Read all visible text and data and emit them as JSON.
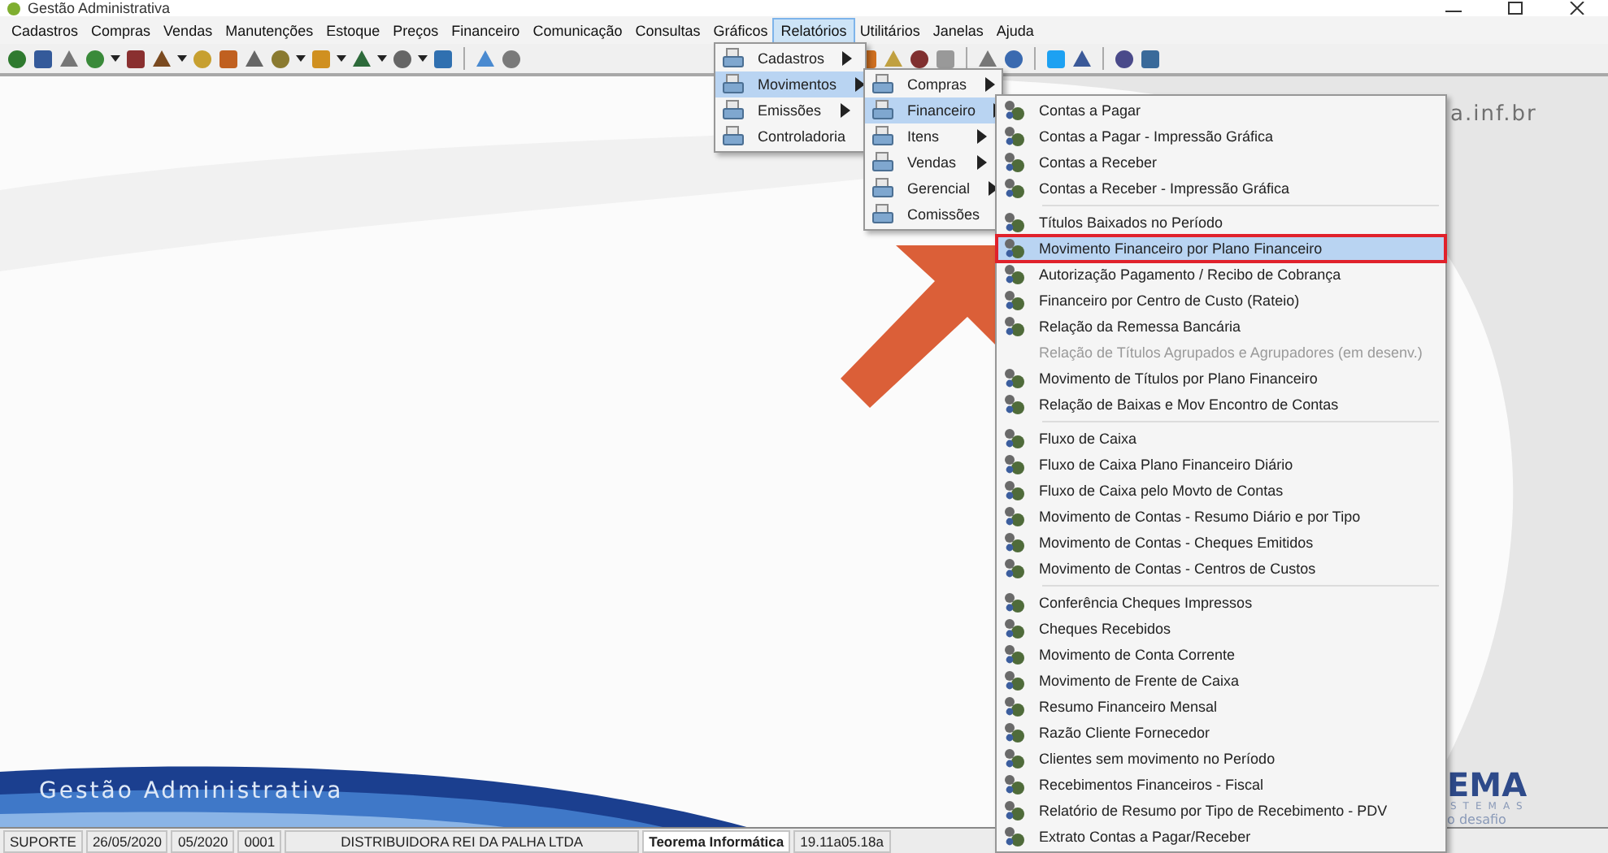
{
  "window": {
    "title": "Gestão Administrativa"
  },
  "menu_bar": [
    {
      "label": "Cadastros",
      "selected": false
    },
    {
      "label": "Compras",
      "selected": false
    },
    {
      "label": "Vendas",
      "selected": false
    },
    {
      "label": "Manutenções",
      "selected": false
    },
    {
      "label": "Estoque",
      "selected": false
    },
    {
      "label": "Preços",
      "selected": false
    },
    {
      "label": "Financeiro",
      "selected": false
    },
    {
      "label": "Comunicação",
      "selected": false
    },
    {
      "label": "Consultas",
      "selected": false
    },
    {
      "label": "Gráficos",
      "selected": false
    },
    {
      "label": "Relatórios",
      "selected": true
    },
    {
      "label": "Utilitários",
      "selected": false
    },
    {
      "label": "Janelas",
      "selected": false
    },
    {
      "label": "Ajuda",
      "selected": false
    }
  ],
  "relatorios_menu": [
    {
      "label": "Cadastros",
      "selected": false
    },
    {
      "label": "Movimentos",
      "selected": true
    },
    {
      "label": "Emissões",
      "selected": false
    },
    {
      "label": "Controladoria",
      "selected": false
    }
  ],
  "movimentos_submenu": [
    {
      "label": "Compras",
      "selected": false
    },
    {
      "label": "Financeiro",
      "selected": true
    },
    {
      "label": "Itens",
      "selected": false
    },
    {
      "label": "Vendas",
      "selected": false
    },
    {
      "label": "Gerencial",
      "selected": false
    },
    {
      "label": "Comissões",
      "selected": false
    }
  ],
  "financeiro_submenu": [
    {
      "kind": "item",
      "label": "Contas a Pagar",
      "selected": false,
      "disabled": false
    },
    {
      "kind": "item",
      "label": "Contas a Pagar - Impressão Gráfica",
      "selected": false,
      "disabled": false
    },
    {
      "kind": "item",
      "label": "Contas a Receber",
      "selected": false,
      "disabled": false
    },
    {
      "kind": "item",
      "label": "Contas a Receber - Impressão Gráfica",
      "selected": false,
      "disabled": false
    },
    {
      "kind": "separator"
    },
    {
      "kind": "item",
      "label": "Títulos Baixados no Período",
      "selected": false,
      "disabled": false
    },
    {
      "kind": "item",
      "label": "Movimento Financeiro por Plano Financeiro",
      "selected": true,
      "disabled": false
    },
    {
      "kind": "item",
      "label": "Autorização Pagamento / Recibo de Cobrança",
      "selected": false,
      "disabled": false
    },
    {
      "kind": "item",
      "label": "Financeiro por Centro de Custo (Rateio)",
      "selected": false,
      "disabled": false
    },
    {
      "kind": "item",
      "label": "Relação da Remessa Bancária",
      "selected": false,
      "disabled": false
    },
    {
      "kind": "item",
      "label": "Relação de Títulos Agrupados e Agrupadores (em desenv.)",
      "selected": false,
      "disabled": true
    },
    {
      "kind": "item",
      "label": "Movimento de Títulos por Plano Financeiro",
      "selected": false,
      "disabled": false
    },
    {
      "kind": "item",
      "label": "Relação de Baixas e Mov Encontro de Contas",
      "selected": false,
      "disabled": false
    },
    {
      "kind": "separator"
    },
    {
      "kind": "item",
      "label": "Fluxo de Caixa",
      "selected": false,
      "disabled": false
    },
    {
      "kind": "item",
      "label": "Fluxo de Caixa Plano Financeiro Diário",
      "selected": false,
      "disabled": false
    },
    {
      "kind": "item",
      "label": "Fluxo de Caixa pelo Movto de Contas",
      "selected": false,
      "disabled": false
    },
    {
      "kind": "item",
      "label": "Movimento de Contas - Resumo Diário e por Tipo",
      "selected": false,
      "disabled": false
    },
    {
      "kind": "item",
      "label": "Movimento de Contas - Cheques Emitidos",
      "selected": false,
      "disabled": false
    },
    {
      "kind": "item",
      "label": "Movimento de Contas - Centros de Custos",
      "selected": false,
      "disabled": false
    },
    {
      "kind": "separator"
    },
    {
      "kind": "item",
      "label": "Conferência Cheques Impressos",
      "selected": false,
      "disabled": false
    },
    {
      "kind": "item",
      "label": "Cheques Recebidos",
      "selected": false,
      "disabled": false
    },
    {
      "kind": "item",
      "label": "Movimento de Conta Corrente",
      "selected": false,
      "disabled": false
    },
    {
      "kind": "item",
      "label": "Movimento de Frente de Caixa",
      "selected": false,
      "disabled": false
    },
    {
      "kind": "item",
      "label": "Resumo Financeiro Mensal",
      "selected": false,
      "disabled": false
    },
    {
      "kind": "item",
      "label": "Razão Cliente Fornecedor",
      "selected": false,
      "disabled": false
    },
    {
      "kind": "item",
      "label": "Clientes sem movimento no Período",
      "selected": false,
      "disabled": false
    },
    {
      "kind": "item",
      "label": "Recebimentos Financeiros - Fiscal",
      "selected": false,
      "disabled": false
    },
    {
      "kind": "item",
      "label": "Relatório de Resumo por Tipo de Recebimento - PDV",
      "selected": false,
      "disabled": false
    },
    {
      "kind": "item",
      "label": "Extrato Contas a Pagar/Receber",
      "selected": false,
      "disabled": false
    }
  ],
  "desktop": {
    "logo_url": "a.inf.br",
    "logo_name": "EMA",
    "logo_subtitle": "STEMAS",
    "logo_tagline": "o desafio",
    "banner_title": "Gestão Administrativa"
  },
  "status_bar": [
    {
      "kind": "plain",
      "text": "SUPORTE"
    },
    {
      "kind": "plain",
      "text": "26/05/2020"
    },
    {
      "kind": "plain",
      "text": "05/2020"
    },
    {
      "kind": "plain",
      "text": "0001"
    },
    {
      "kind": "wide",
      "text": "DISTRIBUIDORA REI DA PALHA LTDA"
    },
    {
      "kind": "bold",
      "text": "Teorema Informática"
    },
    {
      "kind": "plain",
      "text": "19.11a05.18a"
    }
  ]
}
